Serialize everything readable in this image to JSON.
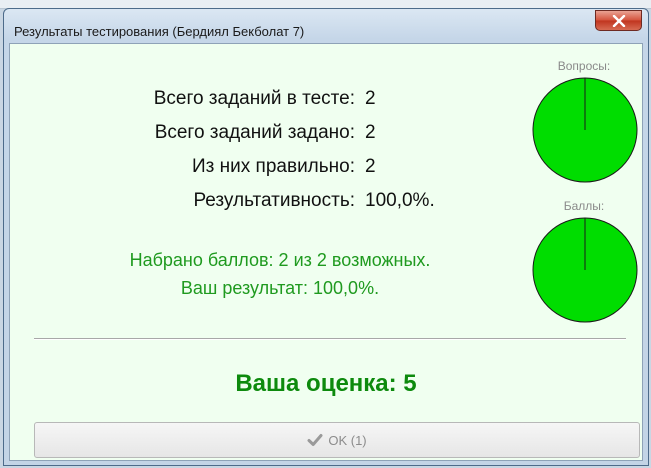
{
  "window": {
    "title": "Результаты тестирования (Бердиял Бекболат 7)"
  },
  "stats": [
    {
      "label": "Всего заданий в тесте:",
      "value": "2"
    },
    {
      "label": "Всего заданий задано:",
      "value": "2"
    },
    {
      "label": "Из них правильно:",
      "value": "2"
    },
    {
      "label": "Результативность:",
      "value": "100,0%."
    }
  ],
  "score": {
    "points_text": "Набрано баллов: 2 из 2 возможных.",
    "result_text": "Ваш результат: 100,0%."
  },
  "pies": {
    "questions": {
      "label": "Вопросы:",
      "fraction": 1.0
    },
    "points": {
      "label": "Баллы:",
      "fraction": 1.0
    },
    "fill_color": "#00dd00",
    "stroke_color": "#1a1a1a"
  },
  "grade": {
    "text": "Ваша оценка: 5"
  },
  "ok_button": {
    "label": "OK (1)",
    "icon": "checkmark-icon"
  },
  "colors": {
    "client_background": "#f0fff0",
    "green_text": "#1f9a1f",
    "grade_text": "#0d8a0d"
  }
}
